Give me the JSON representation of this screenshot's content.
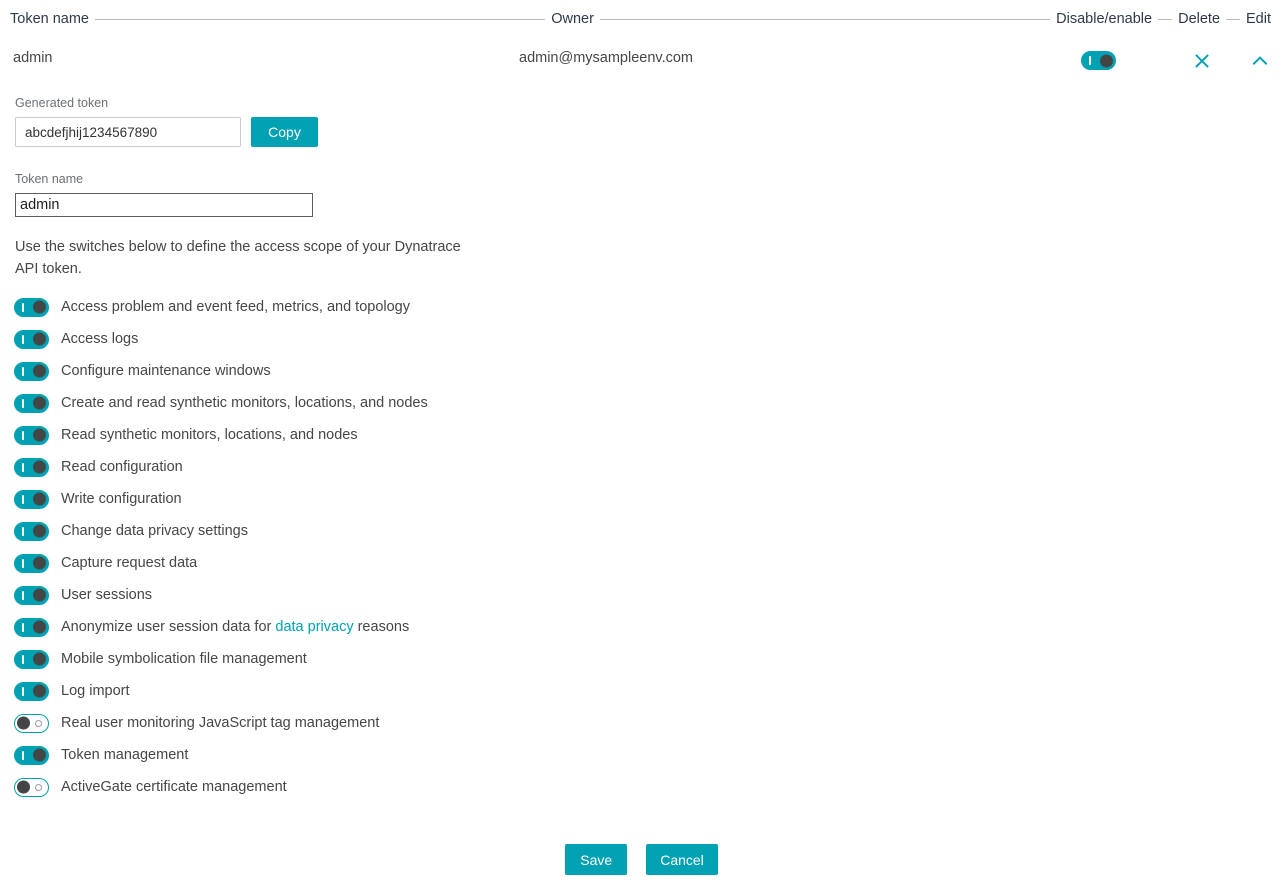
{
  "colors": {
    "accent": "#00a1b2",
    "text": "#454646",
    "header_text": "#2e3a4b",
    "rule": "#b7bdc4",
    "knob": "#454545"
  },
  "table": {
    "columns": [
      {
        "label": "Token name"
      },
      {
        "label": "Owner"
      },
      {
        "label": "Disable/enable"
      },
      {
        "label": "Delete"
      },
      {
        "label": "Edit"
      }
    ],
    "row": {
      "token_name": "admin",
      "owner": "admin@mysampleenv.com",
      "enabled": true,
      "delete_icon": "close-x-icon",
      "edit_icon": "chevron-up-icon"
    }
  },
  "detail": {
    "generated_token": {
      "label": "Generated token",
      "value": "abcdefjhij1234567890",
      "copy_label": "Copy"
    },
    "token_name": {
      "label": "Token name",
      "value": "admin"
    },
    "description": "Use the switches below to define the access scope of your Dynatrace API token.",
    "scopes": [
      {
        "label": "Access problem and event feed, metrics, and topology",
        "on": true
      },
      {
        "label": "Access logs",
        "on": true
      },
      {
        "label": "Configure maintenance windows",
        "on": true
      },
      {
        "label": "Create and read synthetic monitors, locations, and nodes",
        "on": true
      },
      {
        "label": "Read synthetic monitors, locations, and nodes",
        "on": true
      },
      {
        "label": "Read configuration",
        "on": true
      },
      {
        "label": "Write configuration",
        "on": true
      },
      {
        "label": "Change data privacy settings",
        "on": true
      },
      {
        "label": "Capture request data",
        "on": true
      },
      {
        "label": "User sessions",
        "on": true
      },
      {
        "label": "Anonymize user session data for ",
        "link": "data privacy",
        "label_after": " reasons",
        "on": true
      },
      {
        "label": "Mobile symbolication file management",
        "on": true
      },
      {
        "label": "Log import",
        "on": true
      },
      {
        "label": "Real user monitoring JavaScript tag management",
        "on": false
      },
      {
        "label": "Token management",
        "on": true
      },
      {
        "label": "ActiveGate certificate management",
        "on": false
      }
    ]
  },
  "actions": {
    "save_label": "Save",
    "cancel_label": "Cancel"
  }
}
